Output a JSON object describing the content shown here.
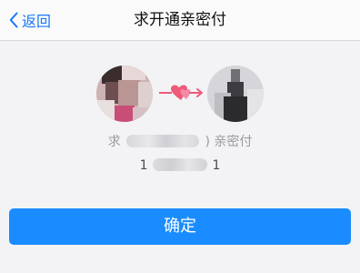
{
  "nav": {
    "back_label": "返回",
    "title": "求开通亲密付"
  },
  "pair": {
    "left_avatar_icon": "user-avatar",
    "right_avatar_icon": "friend-avatar",
    "connector_icon": "heart-arrow-icon",
    "accent": "#ef5a7a"
  },
  "request": {
    "prefix": "求",
    "suffix": ") 亲密付"
  },
  "phone": {
    "start": "1",
    "end": "1"
  },
  "confirm_label": "确定",
  "colors": {
    "primary": "#1a8cff",
    "link": "#1677ff",
    "background": "#f3f3f5"
  }
}
